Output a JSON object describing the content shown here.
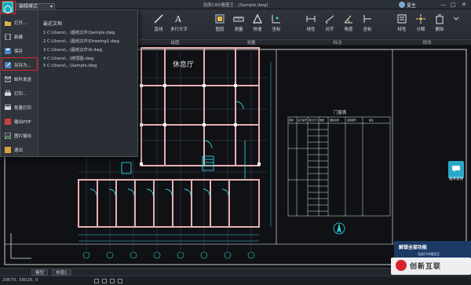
{
  "titlebar": {
    "mode": "编辑模式",
    "doc_title": "浩辰CAD看图王 - [Sample.dwg]",
    "user_name": "夏生",
    "controls": [
      "—",
      "□",
      "✕"
    ]
  },
  "ribbon": {
    "buttons": [
      {
        "label": "直线",
        "icon": "line-icon"
      },
      {
        "label": "多行文字",
        "icon": "mtext-icon"
      },
      {
        "label": "图层",
        "icon": "layers-icon"
      },
      {
        "label": "测量",
        "icon": "measure-icon"
      },
      {
        "label": "快速",
        "icon": "quick-icon"
      },
      {
        "label": "坐标",
        "icon": "coordinate-icon"
      },
      {
        "label": "线性",
        "icon": "linear-dim-icon"
      },
      {
        "label": "对齐",
        "icon": "aligned-dim-icon"
      },
      {
        "label": "角度",
        "icon": "angle-dim-icon"
      },
      {
        "label": "坐标",
        "icon": "ordinate-dim-icon"
      },
      {
        "label": "特性",
        "icon": "properties-icon"
      },
      {
        "label": "分解",
        "icon": "explode-icon"
      },
      {
        "label": "删除",
        "icon": "delete-icon"
      }
    ],
    "groups": [
      "绘图",
      "测量",
      "标注",
      "修改"
    ]
  },
  "file_menu": {
    "items": [
      {
        "label": "打开...",
        "icon": "open-folder-icon"
      },
      {
        "label": "新建",
        "icon": "new-file-icon"
      },
      {
        "label": "保存",
        "icon": "save-icon"
      },
      {
        "label": "另存为...",
        "icon": "save-as-icon"
      },
      {
        "label": "邮件发送",
        "icon": "mail-icon"
      },
      {
        "label": "打印...",
        "icon": "print-icon"
      },
      {
        "label": "批量打印",
        "icon": "batch-print-icon"
      },
      {
        "label": "输出PDF",
        "icon": "pdf-icon"
      },
      {
        "label": "图片输出",
        "icon": "image-export-icon"
      },
      {
        "label": "退出",
        "icon": "exit-icon"
      }
    ],
    "recent_title": "最近文档",
    "recent": [
      "1 C:\\Users\\...\\图纸文件\\Sample.dwg",
      "2 C:\\Users\\...\\图纸文件\\Drawing1.dwg",
      "3 C:\\Users\\...\\图纸文件\\A.dwg",
      "4 C:\\Users\\...\\楼层图.dwg",
      "5 C:\\Users\\...\\Sample.dwg"
    ]
  },
  "drawing": {
    "room_label": "休息厅",
    "table_title": "门窗表",
    "table_headers": [
      "类别",
      "设计编号",
      "洞口尺寸",
      "数量",
      "图集名称",
      "选用型号",
      "备注"
    ]
  },
  "tabs": [
    "模型",
    "布局1"
  ],
  "status": {
    "coords": "29670, 58026, 0"
  },
  "float_widget": {
    "label": "技术支持"
  },
  "promo": {
    "title": "解锁全部功能",
    "subtitle": "浩辰CAD看图王"
  },
  "watermark": {
    "text": "创新互联"
  },
  "colors": {
    "accent": "#1aa9b8",
    "highlight": "#d92a2a",
    "wall": "#ffffff",
    "wall_alt": "#e8b0b0",
    "dim": "#2fd4e0",
    "grid": "#3a4b5a"
  }
}
